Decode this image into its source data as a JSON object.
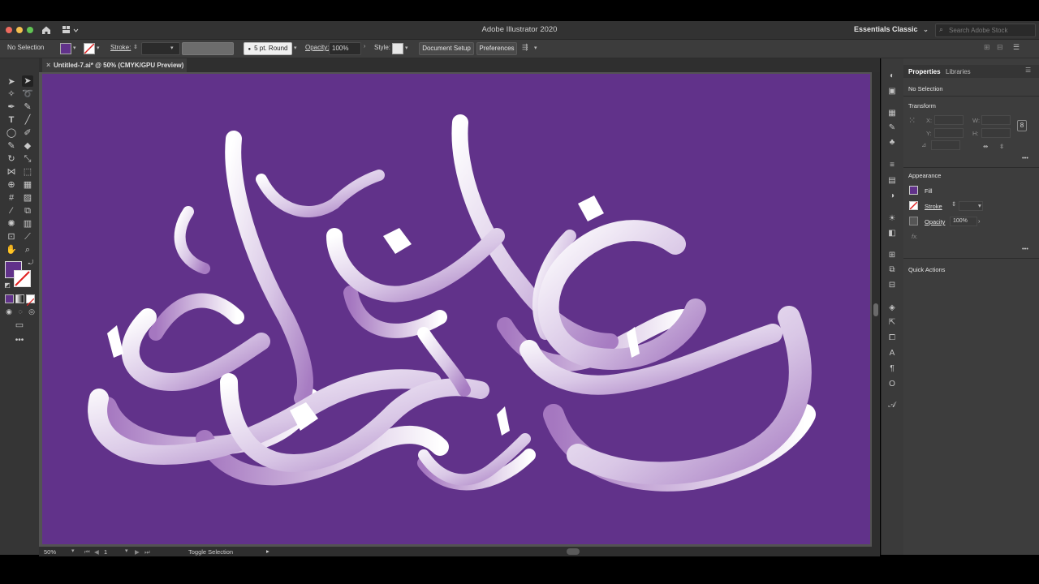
{
  "app": {
    "title": "Adobe Illustrator 2020",
    "workspace": "Essentials Classic",
    "stock_search_placeholder": "Search Adobe Stock"
  },
  "control_bar": {
    "selection_status": "No Selection",
    "fill_color": "#61328a",
    "stroke_label": "Stroke:",
    "brush_label": "5 pt. Round",
    "opacity_label": "Opacity:",
    "opacity_value": "100%",
    "style_label": "Style:",
    "document_setup": "Document Setup",
    "preferences": "Preferences"
  },
  "document": {
    "tab_title": "Untitled-7.ai* @ 50% (CMYK/GPU Preview)",
    "artboard_color": "#61328a",
    "artwork": "Arabic calligraphy — white-to-lavender 3D lettering"
  },
  "status_bar": {
    "zoom": "50%",
    "artboard_number": "1",
    "status_text": "Toggle Selection"
  },
  "properties_panel": {
    "tabs": [
      "Properties",
      "Libraries"
    ],
    "selection": "No Selection",
    "transform_title": "Transform",
    "x_label": "X:",
    "y_label": "Y:",
    "w_label": "W:",
    "h_label": "H:",
    "appearance_title": "Appearance",
    "fill_label": "Fill",
    "stroke_label": "Stroke",
    "opacity_label": "Opacity",
    "opacity_value": "100%",
    "fx_label": "fx.",
    "quick_actions_title": "Quick Actions"
  },
  "colors": {
    "accent_purple": "#61328a",
    "ui_dark": "#3d3d3d"
  }
}
